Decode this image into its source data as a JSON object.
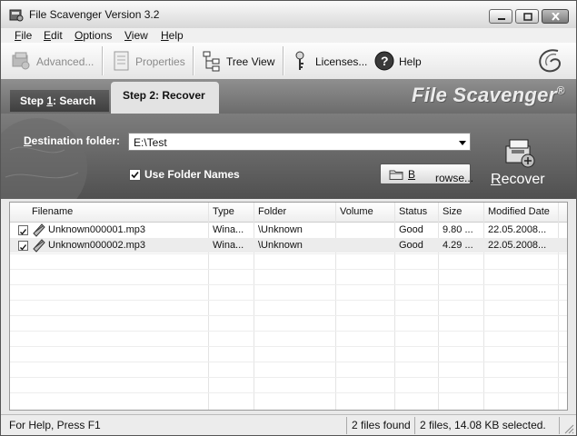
{
  "window": {
    "title": "File Scavenger Version 3.2"
  },
  "menu": [
    {
      "mnemonic": "F",
      "rest": "ile"
    },
    {
      "mnemonic": "E",
      "rest": "dit"
    },
    {
      "mnemonic": "O",
      "rest": "ptions"
    },
    {
      "mnemonic": "V",
      "rest": "iew"
    },
    {
      "mnemonic": "H",
      "rest": "elp"
    }
  ],
  "toolbar": {
    "advanced": "Advanced...",
    "properties": "Properties",
    "tree_view": "Tree View",
    "licenses": "Licenses...",
    "help": "Help"
  },
  "tabs": {
    "step1_pre": "Step ",
    "step1_mnemonic": "1",
    "step1_post": ": Search",
    "step2": "Step 2: Recover"
  },
  "brand": {
    "name": "File Scavenger",
    "mark": "®"
  },
  "recover_panel": {
    "dest_label_mnemonic": "D",
    "dest_label_rest": "estination folder:",
    "dest_value": "E:\\Test",
    "use_folder_names_label": "Use Folder Names",
    "use_folder_names_checked": true,
    "browse_mnemonic": "B",
    "browse_rest": "rowse...",
    "recover_mnemonic": "R",
    "recover_rest": "ecover"
  },
  "table": {
    "columns": [
      "Filename",
      "Type",
      "Folder",
      "Volume",
      "Status",
      "Size",
      "Modified Date"
    ],
    "rows": [
      {
        "checked": true,
        "filename": "Unknown000001.mp3",
        "type": "Wina...",
        "folder": "\\Unknown",
        "volume": "",
        "status": "Good",
        "size": "9.80 ...",
        "modified": "22.05.2008..."
      },
      {
        "checked": true,
        "filename": "Unknown000002.mp3",
        "type": "Wina...",
        "folder": "\\Unknown",
        "volume": "",
        "status": "Good",
        "size": "4.29 ...",
        "modified": "22.05.2008..."
      }
    ]
  },
  "statusbar": {
    "help": "For Help, Press F1",
    "found": "2 files found",
    "selected": "2 files, 14.08 KB selected."
  }
}
